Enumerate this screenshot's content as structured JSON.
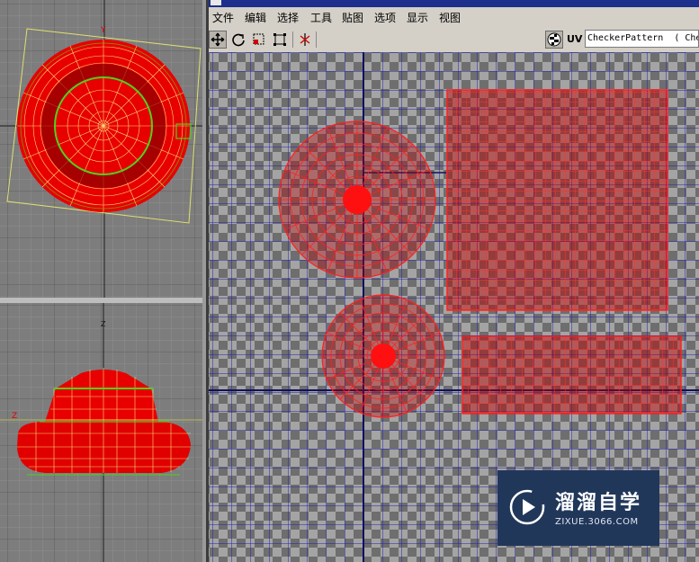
{
  "menu": [
    "文件",
    "编辑",
    "选择",
    "工具",
    "贴图",
    "选项",
    "显示",
    "视图"
  ],
  "toolbar": {
    "tools": [
      {
        "icon": "move-icon"
      },
      {
        "icon": "rotate-icon"
      },
      {
        "icon": "scale-icon"
      },
      {
        "icon": "freeform-icon"
      },
      {
        "icon": "mirror-icon"
      }
    ],
    "checker_icon": "checker-sphere-icon",
    "uv_label": "UV",
    "texture_dropdown": "CheckerPattern  ( Che"
  },
  "viewports": {
    "top": {
      "axis_label": "Y"
    },
    "front": {
      "axis_label_top": "Z",
      "axis_label_left": "Z"
    }
  },
  "watermark": {
    "title": "溜溜自学",
    "url": "ZIXUE.3066.COM"
  },
  "colors": {
    "mesh": "#ff0000",
    "selection": "#50d020",
    "wire": "#ffff80"
  }
}
